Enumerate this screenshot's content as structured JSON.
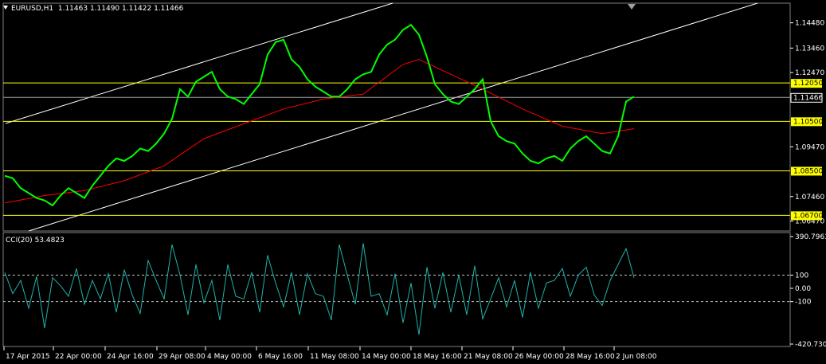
{
  "header": {
    "symbol": "EURUSD,H1",
    "quote": "1.11463 1.11490 1.11422 1.11466"
  },
  "indicator": {
    "name": "CCI(20)",
    "value": "53.4823"
  },
  "price_axis": {
    "ticks": [
      "1.14480",
      "1.13460",
      "1.12470",
      "1.09470",
      "1.07460",
      "1.06470"
    ],
    "max": 1.1521,
    "min": 1.061
  },
  "levels": [
    {
      "label": "1.12050",
      "price": 1.1205
    },
    {
      "label": "1.10500",
      "price": 1.105
    },
    {
      "label": "1.08500",
      "price": 1.085
    },
    {
      "label": "1.06700",
      "price": 1.067
    }
  ],
  "current_price": {
    "label": "1.11466",
    "price": 1.11466
  },
  "cci_axis": {
    "ticks": [
      "390.7963",
      "100",
      "0.00",
      "-100",
      "-420.7303"
    ],
    "max": 390.7963,
    "min": -420.7303
  },
  "time_axis": [
    "17 Apr 2015",
    "22 Apr 00:00",
    "24 Apr 16:00",
    "29 Apr 08:00",
    "4 May 00:00",
    "6 May 16:00",
    "11 May 08:00",
    "14 May 00:00",
    "18 May 16:00",
    "21 May 08:00",
    "26 May 00:00",
    "28 May 16:00",
    "2 Jun 08:00"
  ],
  "colors": {
    "background": "#000000",
    "price_line": "#00ff00",
    "moving_average": "#ff0000",
    "level_line": "#ffff00",
    "channel_line": "#ffffff",
    "cci_line": "#20b2aa"
  },
  "chart_data": {
    "type": "line",
    "series": [
      {
        "x": [
          0,
          10,
          20,
          30,
          40,
          50,
          60,
          70,
          80,
          90,
          100,
          110,
          120,
          130,
          140,
          150,
          160,
          170,
          180,
          190,
          200,
          210,
          220,
          230,
          240,
          250,
          260,
          270,
          280,
          290,
          300,
          310,
          320,
          330,
          340,
          350,
          360,
          370,
          380,
          390,
          400,
          410,
          420,
          430,
          440,
          450,
          460,
          470,
          480,
          490,
          500,
          510,
          520,
          530,
          540,
          550,
          560,
          570,
          580,
          590,
          600,
          610,
          620,
          630,
          640,
          650,
          660,
          670,
          680,
          690,
          700,
          710,
          720,
          730,
          740,
          750,
          760,
          770,
          780,
          790
        ],
        "values": [
          1.083,
          1.082,
          1.078,
          1.076,
          1.074,
          1.073,
          1.071,
          1.075,
          1.078,
          1.076,
          1.074,
          1.079,
          1.083,
          1.087,
          1.09,
          1.089,
          1.091,
          1.094,
          1.093,
          1.096,
          1.1,
          1.106,
          1.118,
          1.115,
          1.121,
          1.123,
          1.125,
          1.118,
          1.115,
          1.114,
          1.112,
          1.116,
          1.12,
          1.132,
          1.137,
          1.138,
          1.13,
          1.127,
          1.122,
          1.119,
          1.117,
          1.115,
          1.115,
          1.118,
          1.122,
          1.124,
          1.125,
          1.132,
          1.136,
          1.138,
          1.142,
          1.144,
          1.14,
          1.131,
          1.12,
          1.116,
          1.113,
          1.112,
          1.115,
          1.118,
          1.122,
          1.105,
          1.099,
          1.097,
          1.096,
          1.092,
          1.089,
          1.088,
          1.09,
          1.091,
          1.089,
          1.094,
          1.097,
          1.099,
          1.096,
          1.093,
          1.092,
          1.099,
          1.113,
          1.115
        ]
      },
      {
        "x": [
          0,
          50,
          100,
          150,
          200,
          250,
          300,
          350,
          400,
          450,
          500,
          520,
          560,
          600,
          650,
          700,
          750,
          790
        ],
        "values": [
          1.072,
          1.075,
          1.077,
          1.081,
          1.087,
          1.098,
          1.104,
          1.11,
          1.114,
          1.116,
          1.128,
          1.13,
          1.124,
          1.118,
          1.11,
          1.103,
          1.1,
          1.102
        ]
      },
      {
        "x": [
          0,
          10,
          20,
          30,
          40,
          50,
          60,
          70,
          80,
          90,
          100,
          110,
          120,
          130,
          140,
          150,
          160,
          170,
          180,
          190,
          200,
          210,
          220,
          230,
          240,
          250,
          260,
          270,
          280,
          290,
          300,
          310,
          320,
          330,
          340,
          350,
          360,
          370,
          380,
          390,
          400,
          410,
          420,
          430,
          440,
          450,
          460,
          470,
          480,
          490,
          500,
          510,
          520,
          530,
          540,
          550,
          560,
          570,
          580,
          590,
          600,
          610,
          620,
          630,
          640,
          650,
          660,
          670,
          680,
          690,
          700,
          710,
          720,
          730,
          740,
          750,
          760,
          770,
          780,
          790
        ],
        "values": [
          120,
          -40,
          60,
          -150,
          90,
          -300,
          80,
          20,
          -60,
          150,
          -120,
          60,
          -80,
          110,
          -180,
          140,
          -50,
          -190,
          210,
          60,
          -80,
          330,
          100,
          -200,
          180,
          -110,
          60,
          -240,
          180,
          -60,
          -80,
          120,
          -180,
          250,
          40,
          -140,
          120,
          -200,
          110,
          -40,
          -60,
          -240,
          330,
          100,
          -120,
          340,
          -60,
          -40,
          -200,
          110,
          -260,
          40,
          -350,
          160,
          -150,
          120,
          -180,
          100,
          -200,
          170,
          -230,
          -80,
          80,
          -140,
          60,
          -220,
          120,
          -150,
          40,
          60,
          150,
          -60,
          100,
          160,
          -50,
          -130,
          60,
          180,
          300,
          80
        ]
      }
    ]
  }
}
